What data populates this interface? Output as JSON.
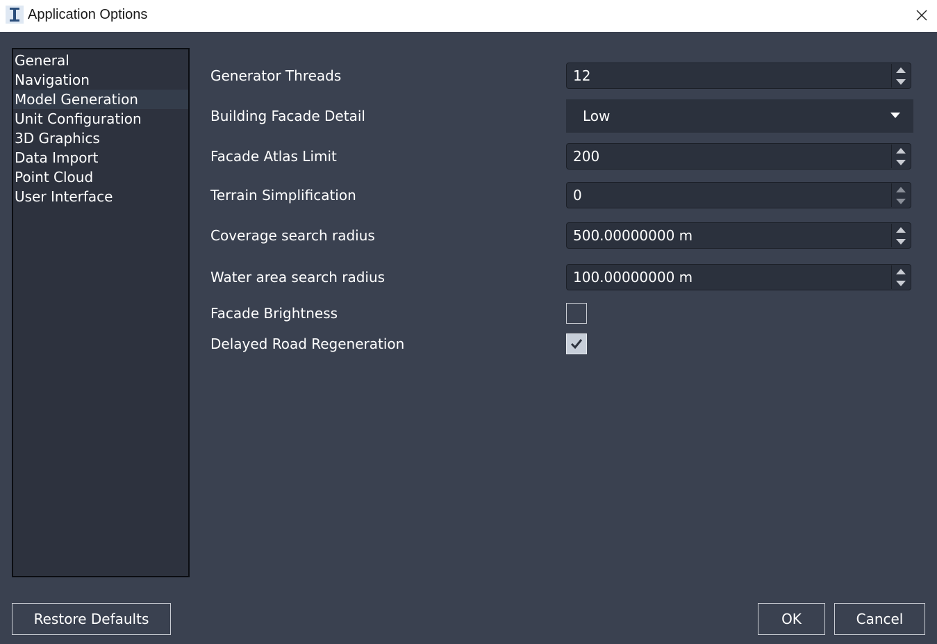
{
  "window": {
    "title": "Application Options",
    "icon": "app-i-icon",
    "close_icon": "close-icon"
  },
  "sidebar": {
    "items": [
      {
        "label": "General"
      },
      {
        "label": "Navigation"
      },
      {
        "label": "Model Generation",
        "selected": true
      },
      {
        "label": "Unit Configuration"
      },
      {
        "label": "3D Graphics"
      },
      {
        "label": "Data Import"
      },
      {
        "label": "Point Cloud"
      },
      {
        "label": "User Interface"
      }
    ]
  },
  "settings": {
    "generator_threads": {
      "label": "Generator Threads",
      "value": "12"
    },
    "building_facade_detail": {
      "label": "Building Facade Detail",
      "value": "Low"
    },
    "facade_atlas_limit": {
      "label": "Facade Atlas Limit",
      "value": "200"
    },
    "terrain_simplification": {
      "label": "Terrain Simplification",
      "value": "0"
    },
    "coverage_search_radius": {
      "label": "Coverage search radius",
      "value": "500.00000000 m"
    },
    "water_area_search_radius": {
      "label": "Water area search radius",
      "value": "100.00000000 m"
    },
    "facade_brightness": {
      "label": "Facade Brightness",
      "checked": false
    },
    "delayed_road_regeneration": {
      "label": "Delayed Road Regeneration",
      "checked": true
    }
  },
  "buttons": {
    "restore_defaults": "Restore Defaults",
    "ok": "OK",
    "cancel": "Cancel"
  },
  "colors": {
    "background": "#3a4150",
    "panel": "#2d323e",
    "field": "#2b313d",
    "selected_item": "#343d4b",
    "text": "#ffffff"
  }
}
